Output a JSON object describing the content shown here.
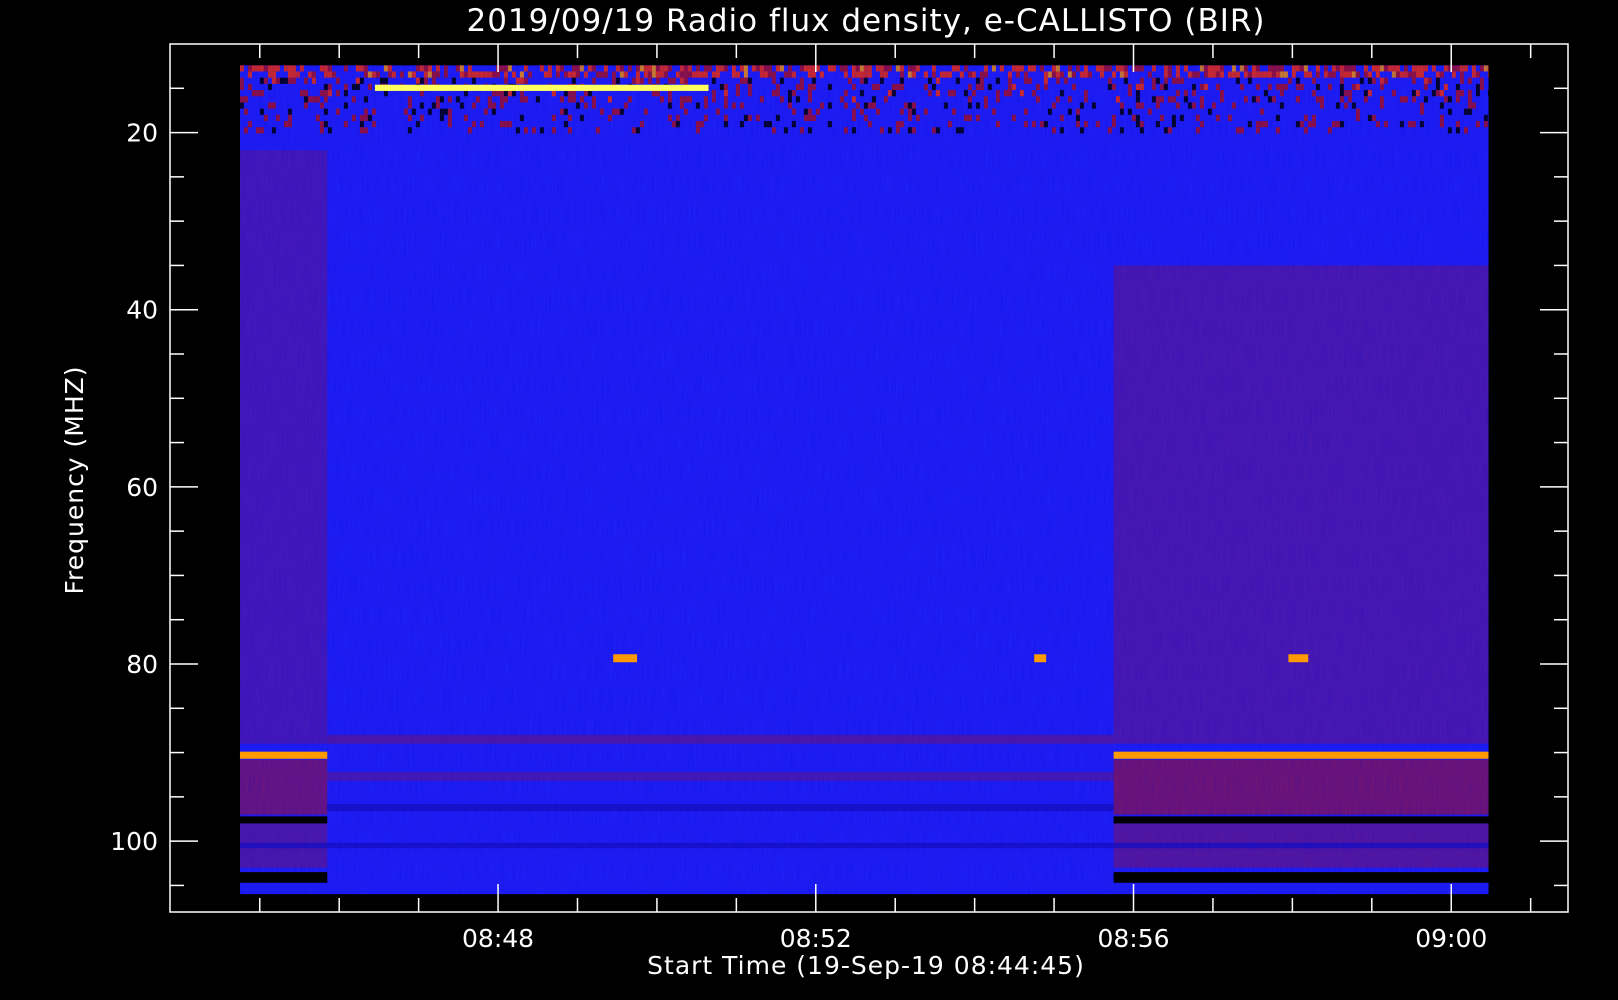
{
  "chart_data": {
    "type": "heatmap",
    "title": "2019/09/19  Radio flux density, e-CALLISTO (BIR)",
    "xlabel": "Start Time (19-Sep-19 08:44:45)",
    "ylabel": "Frequency (MHZ)",
    "x_range_minutes": [
      -0.88,
      16.72
    ],
    "x_data_range_minutes": [
      0.0,
      15.72
    ],
    "x_ticks": [
      {
        "value": 3.25,
        "label": "08:48"
      },
      {
        "value": 7.25,
        "label": "08:52"
      },
      {
        "value": 11.25,
        "label": "08:56"
      },
      {
        "value": 15.25,
        "label": "09:00"
      }
    ],
    "x_minor_ticks": [
      0.25,
      1.25,
      2.25,
      4.25,
      5.25,
      6.25,
      8.25,
      9.25,
      10.25,
      12.25,
      13.25,
      14.25,
      16.25
    ],
    "y_range": [
      10,
      108
    ],
    "y_data_range": [
      12.4,
      106
    ],
    "y_reversed": true,
    "y_ticks": [
      20,
      40,
      60,
      80,
      100
    ],
    "y_minor_ticks": [
      15,
      25,
      30,
      35,
      45,
      50,
      55,
      65,
      70,
      75,
      85,
      90,
      95,
      105
    ],
    "colormap": [
      "#000000",
      "#1a10c8",
      "#2020ff",
      "#b01020",
      "#ff3000",
      "#ff9a00",
      "#ffff60"
    ],
    "background_color": "#2020ff",
    "grid": false,
    "features": [
      {
        "t0": 1.7,
        "t1": 5.9,
        "f0": 14.6,
        "f1": 15.3,
        "level": 0.93
      },
      {
        "t0": 4.7,
        "t1": 5.0,
        "f0": 78.9,
        "f1": 79.8,
        "level": 0.75
      },
      {
        "t0": 10.0,
        "t1": 10.15,
        "f0": 78.9,
        "f1": 79.8,
        "level": 0.75
      },
      {
        "t0": 13.2,
        "t1": 13.45,
        "f0": 78.9,
        "f1": 79.8,
        "level": 0.8
      },
      {
        "t0": 0.0,
        "t1": 1.1,
        "f0": 89.9,
        "f1": 90.7,
        "level": 0.85
      },
      {
        "t0": 11.0,
        "t1": 15.72,
        "f0": 89.9,
        "f1": 90.7,
        "level": 0.85
      },
      {
        "t0": 0.0,
        "t1": 1.1,
        "f0": 97.2,
        "f1": 98.0,
        "level": 0.0
      },
      {
        "t0": 11.0,
        "t1": 15.72,
        "f0": 97.2,
        "f1": 98.0,
        "level": 0.0
      },
      {
        "t0": 0.0,
        "t1": 1.1,
        "f0": 103.5,
        "f1": 104.7,
        "level": 0.0
      },
      {
        "t0": 11.0,
        "t1": 15.72,
        "f0": 103.5,
        "f1": 104.7,
        "level": 0.0
      }
    ]
  }
}
